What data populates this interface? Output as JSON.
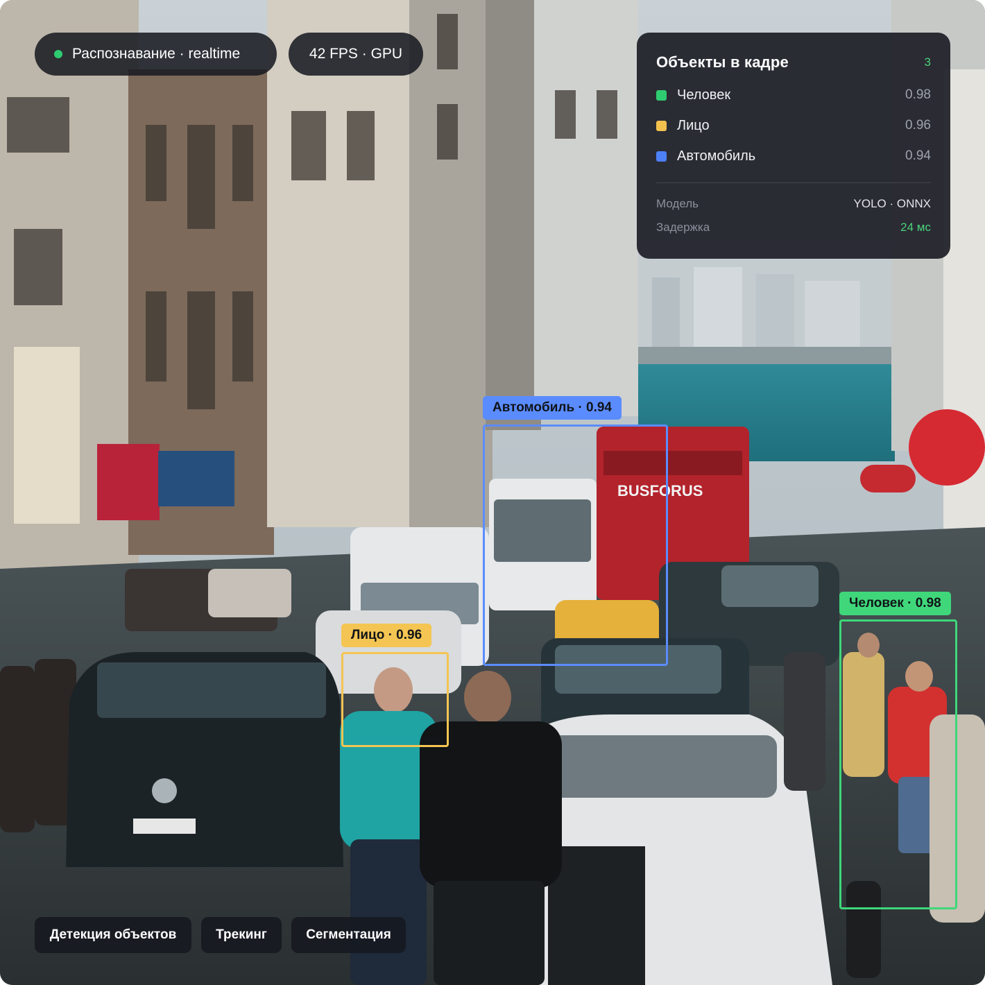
{
  "status": {
    "mode_label": "Распознавание · realtime",
    "perf_label": "42 FPS · GPU",
    "live_color": "#2ecc71"
  },
  "objects_panel": {
    "title": "Объекты в кадре",
    "count": "3",
    "items": [
      {
        "label": "Человек",
        "score": "0.98",
        "color": "#2ecc71"
      },
      {
        "label": "Лицо",
        "score": "0.96",
        "color": "#f2c14e"
      },
      {
        "label": "Автомобиль",
        "score": "0.94",
        "color": "#4d7ff5"
      }
    ],
    "model_label": "Модель",
    "model_value": "YOLO · ONNX",
    "latency_label": "Задержка",
    "latency_value": "24 мс",
    "latency_color": "#4ad27a"
  },
  "detections": {
    "car": {
      "label": "Автомобиль · 0.94",
      "color": "#5b8cff"
    },
    "face": {
      "label": "Лицо · 0.96",
      "color": "#f4c552"
    },
    "person": {
      "label": "Человек · 0.98",
      "color": "#3fd77a"
    }
  },
  "mode_tabs": [
    "Детекция объектов",
    "Трекинг",
    "Сегментация"
  ]
}
